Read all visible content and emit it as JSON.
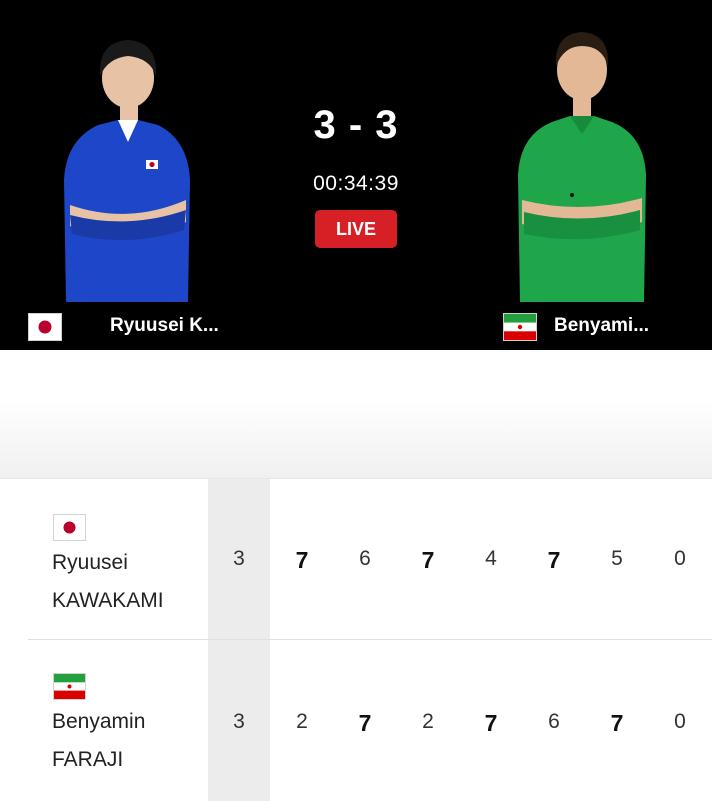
{
  "header": {
    "score": "3 - 3",
    "timer": "00:34:39",
    "live_label": "LIVE",
    "left_player": {
      "short_name": "Ryuusei K...",
      "flag": "japan-flag-icon"
    },
    "right_player": {
      "short_name": "Benyami...",
      "flag": "iran-flag-icon"
    }
  },
  "scoreboard": {
    "players": [
      {
        "first_name": "Ryuusei",
        "last_name": "KAWAKAMI",
        "games_won": "3",
        "game_scores": [
          "7",
          "6",
          "7",
          "4",
          "7",
          "5",
          "0"
        ],
        "flag": "japan-flag-icon"
      },
      {
        "first_name": "Benyamin",
        "last_name": "FARAJI",
        "games_won": "3",
        "game_scores": [
          "2",
          "7",
          "2",
          "7",
          "6",
          "7",
          "0"
        ],
        "flag": "iran-flag-icon"
      }
    ]
  },
  "colors": {
    "header_bg": "#000000",
    "live_badge": "#d71f26",
    "japan_kit": "#1e46c8",
    "iran_kit": "#1fa54a",
    "games_column_bg": "#ececec"
  }
}
